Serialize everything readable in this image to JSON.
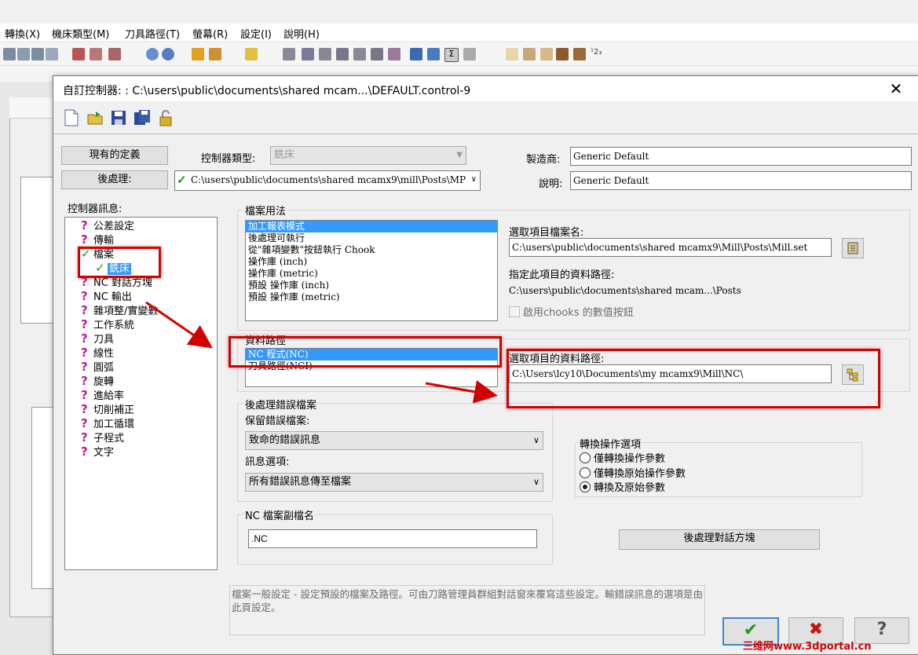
{
  "menubar": {
    "items": [
      "轉換(X)",
      "機床類型(M)",
      "刀具路徑(T)",
      "螢幕(R)",
      "設定(I)",
      "說明(H)"
    ]
  },
  "dialog": {
    "title": "自訂控制器: : C:\\users\\public\\documents\\shared mcam...\\DEFAULT.control-9",
    "close": "✕",
    "current_def_btn": "現有的定義",
    "post_btn": "後處理:",
    "controller_type_label": "控制器類型:",
    "controller_type_value": "銑床",
    "post_path": "C:\\users\\public\\documents\\shared mcamx9\\mill\\Posts\\MP",
    "manufacturer_label": "製造商:",
    "manufacturer_value": "Generic Default",
    "description_label": "說明:",
    "description_value": "Generic Default",
    "tree_label": "控制器訊息:",
    "tree_items": [
      "公差設定",
      "傳輸",
      "檔案",
      "銑床",
      "NC 對話方塊",
      "NC 輸出",
      "雜項整/實變數",
      "工作系統",
      "刀具",
      "線性",
      "圓弧",
      "旋轉",
      "進給率",
      "切削補正",
      "加工循環",
      "子程式",
      "文字"
    ],
    "file_usage": {
      "label": "檔案用法",
      "items": [
        "加工報表模式",
        "後處理可執行",
        "從\"雜項變數\"按鈕執行 Chook",
        "操作庫 (inch)",
        "操作庫 (metric)",
        "預設 操作庫 (inch)",
        "預設 操作庫 (metric)"
      ],
      "selected_file_label": "選取項目檔案名:",
      "selected_file_value": "C:\\users\\public\\documents\\shared mcamx9\\Mill\\Posts\\Mill.set",
      "path_label": "指定此項目的資料路徑:",
      "path_value": "C:\\users\\public\\documents\\shared mcam...\\Posts",
      "chooks_checkbox": "啟用chooks 的數值按鈕"
    },
    "data_path": {
      "label": "資料路徑",
      "items": [
        "NC 程式(NC)",
        "刀具路徑(NCI)"
      ],
      "selected_path_label": "選取項目的資料路徑:",
      "selected_path_value": "C:\\Users\\lcy10\\Documents\\my mcamx9\\Mill\\NC\\"
    },
    "post_error": {
      "label": "後處理錯誤檔案",
      "keep_label": "保留錯誤檔案:",
      "keep_value": "致命的錯誤訊息",
      "msg_label": "訊息選項:",
      "msg_value": "所有錯誤訊息傳至檔案"
    },
    "convert_ops": {
      "label": "轉換操作選項",
      "options": [
        "僅轉換操作參數",
        "僅轉換原始操作參數",
        "轉換及原始參數"
      ],
      "selected": 2
    },
    "nc_ext": {
      "label": "NC 檔案副檔名",
      "value": ".NC"
    },
    "post_dialog_btn": "後處理對話方塊",
    "help_text": "檔案一般設定 - 設定預設的檔案及路徑。可由刀路管理員群組對話窗來覆寫這些設定。輸錯誤訊息的選項是由此頁設定。",
    "ok": "✔",
    "cancel": "✖",
    "help": "?"
  },
  "watermark": "三维网www.3dportal.cn",
  "colors": {
    "selection": "#3399ff",
    "annotation": "#d40000",
    "check": "#1a9a1a",
    "question": "#c2188f"
  }
}
